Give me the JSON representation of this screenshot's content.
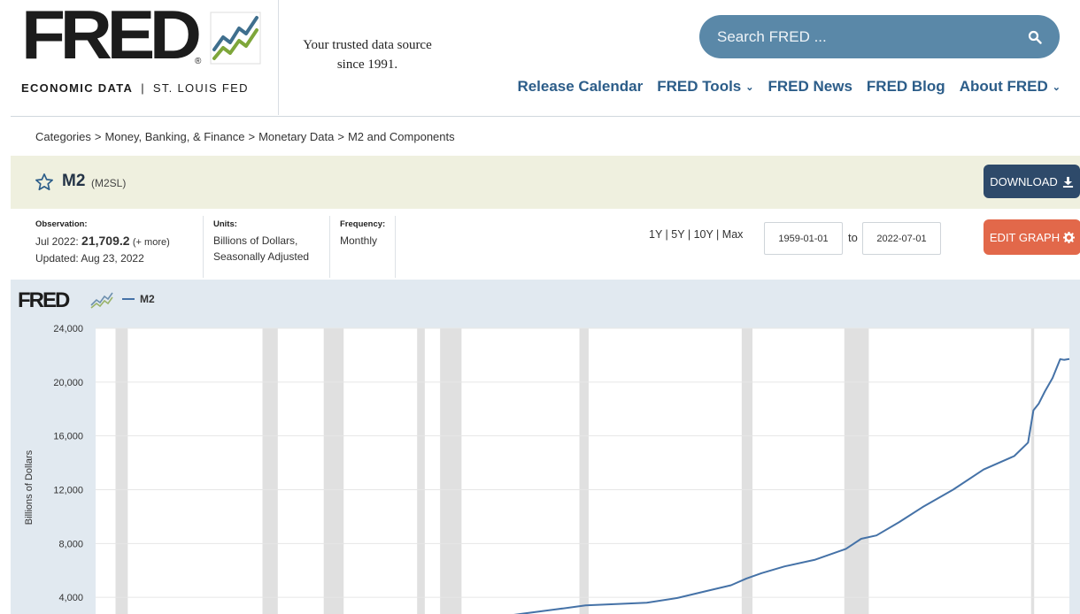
{
  "brand": {
    "wordmark": "FRED",
    "registered": "®",
    "tagline_bold": "ECONOMIC DATA",
    "tagline_sep": "|",
    "tagline_org": "ST. LOUIS FED",
    "slogan_line1": "Your trusted data source",
    "slogan_line2": "since 1991."
  },
  "search": {
    "placeholder": "Search FRED ..."
  },
  "nav": {
    "items": [
      {
        "label": "Release Calendar",
        "dropdown": false
      },
      {
        "label": "FRED Tools",
        "dropdown": true
      },
      {
        "label": "FRED News",
        "dropdown": false
      },
      {
        "label": "FRED Blog",
        "dropdown": false
      },
      {
        "label": "About FRED",
        "dropdown": true
      }
    ]
  },
  "breadcrumb": [
    "Categories",
    "Money, Banking, & Finance",
    "Monetary Data",
    "M2 and Components"
  ],
  "series": {
    "title": "M2",
    "id": "(M2SL)",
    "download_label": "DOWNLOAD"
  },
  "meta": {
    "observation_label": "Observation:",
    "observation_date": "Jul 2022:",
    "observation_value": "21,709.2",
    "observation_more": "(+ more)",
    "updated": "Updated: Aug 23, 2022",
    "units_label": "Units:",
    "units_line1": "Billions of Dollars,",
    "units_line2": "Seasonally Adjusted",
    "frequency_label": "Frequency:",
    "frequency_value": "Monthly"
  },
  "controls": {
    "ranges": [
      "1Y",
      "5Y",
      "10Y",
      "Max"
    ],
    "start_date": "1959-01-01",
    "to_label": "to",
    "end_date": "2022-07-01",
    "edit_label": "EDIT GRAPH"
  },
  "colors": {
    "series_line": "#4572a7",
    "recession_band": "#e0e0e0",
    "download_bg": "#2e4a6a",
    "edit_bg": "#e2684a",
    "search_bg": "#5a88a8",
    "nav_text": "#2c5d89"
  },
  "chart_data": {
    "type": "line",
    "legend": "M2",
    "ylabel": "Billions of Dollars",
    "ylim": [
      0,
      24000
    ],
    "xlim": [
      1959.0,
      2022.6
    ],
    "y_ticks": [
      "4,000",
      "8,000",
      "12,000",
      "16,000",
      "20,000",
      "24,000"
    ],
    "recessions": [
      [
        1960.3,
        1961.1
      ],
      [
        1969.9,
        1970.9
      ],
      [
        1973.9,
        1975.2
      ],
      [
        1980.0,
        1980.5
      ],
      [
        1981.5,
        1982.9
      ],
      [
        1990.6,
        1991.2
      ],
      [
        2001.2,
        2001.9
      ],
      [
        2007.9,
        2009.5
      ],
      [
        2020.1,
        2020.3
      ]
    ],
    "series": [
      {
        "name": "M2",
        "x": [
          1985.0,
          1987.0,
          1989.0,
          1991.0,
          1993.0,
          1995.0,
          1997.0,
          1999.0,
          2000.5,
          2001.5,
          2002.5,
          2004.0,
          2006.0,
          2008.0,
          2009.0,
          2010.0,
          2011.5,
          2013.0,
          2015.0,
          2017.0,
          2019.0,
          2019.9,
          2020.25,
          2020.6,
          2021.0,
          2021.5,
          2022.0,
          2022.25,
          2022.6
        ],
        "y": [
          2500,
          2800,
          3100,
          3400,
          3500,
          3600,
          3950,
          4500,
          4900,
          5400,
          5800,
          6300,
          6800,
          7600,
          8350,
          8600,
          9600,
          10700,
          12000,
          13500,
          14500,
          15500,
          17900,
          18400,
          19300,
          20300,
          21700,
          21650,
          21709
        ]
      }
    ]
  }
}
